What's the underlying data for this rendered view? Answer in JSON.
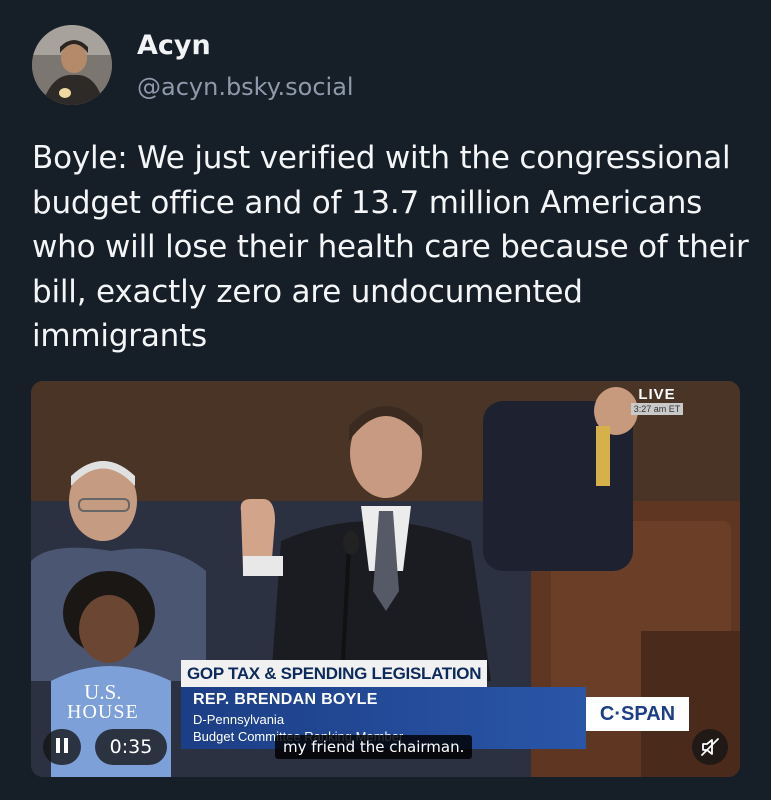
{
  "post": {
    "display_name": "Acyn",
    "handle": "@acyn.bsky.social",
    "text": "Boyle: We just verified with the congressional budget office and of 13.7 million Americans who will lose their health care because of their bill, exactly zero are undocumented immigrants"
  },
  "video": {
    "live_label": "LIVE",
    "live_time": "3:27 am ET",
    "chyron_title": "GOP TAX & SPENDING LEGISLATION",
    "chyron_name": "REP. BRENDAN BOYLE",
    "chyron_state": "D-Pennsylvania",
    "chyron_role": "Budget Committee Ranking Member",
    "network": "C·SPAN",
    "house_logo_line1": "U.S.",
    "house_logo_line2": "HOUSE",
    "caption": "my friend the chairman.",
    "elapsed_time": "0:35",
    "icons": {
      "pause": "pause-icon",
      "mute": "speaker-muted-icon"
    }
  },
  "colors": {
    "background": "#161e27",
    "handle": "#8e9aab",
    "chyron_blue": "#1c3e86"
  }
}
